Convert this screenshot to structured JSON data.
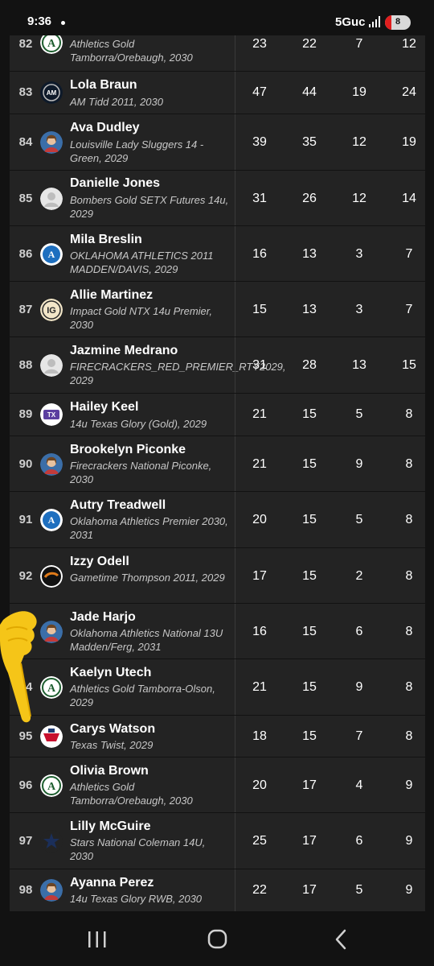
{
  "status_bar": {
    "time": "9:36",
    "network": "5Guc",
    "battery": "8"
  },
  "rows": [
    {
      "rank": "82",
      "name": "",
      "team": "Athletics Gold Tamborra/Orebaugh, 2030",
      "logo": "athletics-a-logo",
      "stats": [
        "23",
        "22",
        "7",
        "12"
      ]
    },
    {
      "rank": "83",
      "name": "Lola Braun",
      "team": "AM Tidd 2011, 2030",
      "logo": "am-team-logo",
      "stats": [
        "47",
        "44",
        "19",
        "24"
      ]
    },
    {
      "rank": "84",
      "name": "Ava Dudley",
      "team": "Louisville Lady Sluggers 14 - Green, 2029",
      "logo": "player-photo",
      "stats": [
        "39",
        "35",
        "12",
        "19"
      ]
    },
    {
      "rank": "85",
      "name": "Danielle Jones",
      "team": "Bombers Gold SETX Futures 14u, 2029",
      "logo": "default-avatar",
      "stats": [
        "31",
        "26",
        "12",
        "14"
      ]
    },
    {
      "rank": "86",
      "name": "Mila Breslin",
      "team": "OKLAHOMA ATHLETICS 2011 MADDEN/DAVIS, 2029",
      "logo": "oklahoma-athletics-logo",
      "stats": [
        "16",
        "13",
        "3",
        "7"
      ]
    },
    {
      "rank": "87",
      "name": "Allie Martinez",
      "team": "Impact Gold NTX 14u Premier, 2030",
      "logo": "impact-gold-logo",
      "stats": [
        "15",
        "13",
        "3",
        "7"
      ]
    },
    {
      "rank": "88",
      "name": "Jazmine Medrano",
      "team": "FIRECRACKERS_RED_PREMIER_RTY2029, 2029",
      "logo": "default-avatar",
      "stats": [
        "31",
        "28",
        "13",
        "15"
      ]
    },
    {
      "rank": "89",
      "name": "Hailey Keel",
      "team": "14u Texas Glory (Gold), 2029",
      "logo": "texas-glory-logo",
      "stats": [
        "21",
        "15",
        "5",
        "8"
      ]
    },
    {
      "rank": "90",
      "name": "Brookelyn Piconke",
      "team": "Firecrackers National Piconke, 2030",
      "logo": "player-photo",
      "stats": [
        "21",
        "15",
        "9",
        "8"
      ]
    },
    {
      "rank": "91",
      "name": "Autry Treadwell",
      "team": "Oklahoma Athletics Premier 2030, 2031",
      "logo": "oklahoma-athletics-logo",
      "stats": [
        "20",
        "15",
        "5",
        "8"
      ]
    },
    {
      "rank": "92",
      "name": "Izzy Odell",
      "team": "Gametime Thompson 2011, 2029",
      "logo": "gametime-logo",
      "stats": [
        "17",
        "15",
        "2",
        "8"
      ]
    },
    {
      "rank": "93",
      "name": "Jade Harjo",
      "team": "Oklahoma Athletics National 13U Madden/Ferg, 2031",
      "logo": "player-photo",
      "stats": [
        "16",
        "15",
        "6",
        "8"
      ]
    },
    {
      "rank": "94",
      "name": "Kaelyn Utech",
      "team": "Athletics Gold Tamborra-Olson, 2029",
      "logo": "athletics-a-logo",
      "stats": [
        "21",
        "15",
        "9",
        "8"
      ]
    },
    {
      "rank": "95",
      "name": "Carys Watson",
      "team": "Texas Twist, 2029",
      "logo": "texas-twist-logo",
      "stats": [
        "18",
        "15",
        "7",
        "8"
      ]
    },
    {
      "rank": "96",
      "name": "Olivia Brown",
      "team": "Athletics Gold Tamborra/Orebaugh, 2030",
      "logo": "athletics-a-logo",
      "stats": [
        "20",
        "17",
        "4",
        "9"
      ]
    },
    {
      "rank": "97",
      "name": "Lilly McGuire",
      "team": "Stars National Coleman 14U, 2030",
      "logo": "stars-national-logo",
      "stats": [
        "25",
        "17",
        "6",
        "9"
      ]
    },
    {
      "rank": "98",
      "name": "Ayanna Perez",
      "team": "14u Texas Glory RWB, 2030",
      "logo": "player-photo",
      "stats": [
        "22",
        "17",
        "5",
        "9"
      ]
    }
  ]
}
